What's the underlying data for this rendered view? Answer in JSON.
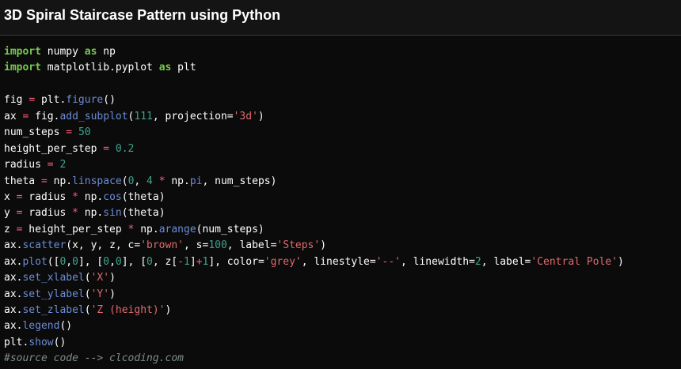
{
  "header": {
    "title": "3D Spiral Staircase Pattern using Python"
  },
  "code": {
    "lines": [
      [
        {
          "t": "import",
          "c": "kw"
        },
        {
          "t": " numpy "
        },
        {
          "t": "as",
          "c": "kw"
        },
        {
          "t": " np"
        }
      ],
      [
        {
          "t": "import",
          "c": "kw"
        },
        {
          "t": " matplotlib.pyplot "
        },
        {
          "t": "as",
          "c": "kw"
        },
        {
          "t": " plt"
        }
      ],
      [],
      [
        {
          "t": "fig "
        },
        {
          "t": "=",
          "c": "op"
        },
        {
          "t": " plt."
        },
        {
          "t": "figure",
          "c": "fn"
        },
        {
          "t": "()"
        }
      ],
      [
        {
          "t": "ax "
        },
        {
          "t": "=",
          "c": "op"
        },
        {
          "t": " fig."
        },
        {
          "t": "add_subplot",
          "c": "fn"
        },
        {
          "t": "("
        },
        {
          "t": "111",
          "c": "num"
        },
        {
          "t": ", projection="
        },
        {
          "t": "'3d'",
          "c": "str"
        },
        {
          "t": ")"
        }
      ],
      [
        {
          "t": "num_steps "
        },
        {
          "t": "=",
          "c": "op"
        },
        {
          "t": " "
        },
        {
          "t": "50",
          "c": "num"
        }
      ],
      [
        {
          "t": "height_per_step "
        },
        {
          "t": "=",
          "c": "op"
        },
        {
          "t": " "
        },
        {
          "t": "0.2",
          "c": "num"
        }
      ],
      [
        {
          "t": "radius "
        },
        {
          "t": "=",
          "c": "op"
        },
        {
          "t": " "
        },
        {
          "t": "2",
          "c": "num"
        }
      ],
      [
        {
          "t": "theta "
        },
        {
          "t": "=",
          "c": "op"
        },
        {
          "t": " np."
        },
        {
          "t": "linspace",
          "c": "fn"
        },
        {
          "t": "("
        },
        {
          "t": "0",
          "c": "num"
        },
        {
          "t": ", "
        },
        {
          "t": "4",
          "c": "num"
        },
        {
          "t": " "
        },
        {
          "t": "*",
          "c": "op"
        },
        {
          "t": " np."
        },
        {
          "t": "pi",
          "c": "fn"
        },
        {
          "t": ", num_steps)"
        }
      ],
      [
        {
          "t": "x "
        },
        {
          "t": "=",
          "c": "op"
        },
        {
          "t": " radius "
        },
        {
          "t": "*",
          "c": "op"
        },
        {
          "t": " np."
        },
        {
          "t": "cos",
          "c": "fn"
        },
        {
          "t": "(theta)"
        }
      ],
      [
        {
          "t": "y "
        },
        {
          "t": "=",
          "c": "op"
        },
        {
          "t": " radius "
        },
        {
          "t": "*",
          "c": "op"
        },
        {
          "t": " np."
        },
        {
          "t": "sin",
          "c": "fn"
        },
        {
          "t": "(theta)"
        }
      ],
      [
        {
          "t": "z "
        },
        {
          "t": "=",
          "c": "op"
        },
        {
          "t": " height_per_step "
        },
        {
          "t": "*",
          "c": "op"
        },
        {
          "t": " np."
        },
        {
          "t": "arange",
          "c": "fn"
        },
        {
          "t": "(num_steps)"
        }
      ],
      [
        {
          "t": "ax."
        },
        {
          "t": "scatter",
          "c": "fn"
        },
        {
          "t": "(x, y, z, c="
        },
        {
          "t": "'brown'",
          "c": "str"
        },
        {
          "t": ", s="
        },
        {
          "t": "100",
          "c": "num"
        },
        {
          "t": ", label="
        },
        {
          "t": "'Steps'",
          "c": "str"
        },
        {
          "t": ")"
        }
      ],
      [
        {
          "t": "ax."
        },
        {
          "t": "plot",
          "c": "fn"
        },
        {
          "t": "(["
        },
        {
          "t": "0",
          "c": "num"
        },
        {
          "t": ","
        },
        {
          "t": "0",
          "c": "num"
        },
        {
          "t": "], ["
        },
        {
          "t": "0",
          "c": "num"
        },
        {
          "t": ","
        },
        {
          "t": "0",
          "c": "num"
        },
        {
          "t": "], ["
        },
        {
          "t": "0",
          "c": "num"
        },
        {
          "t": ", z["
        },
        {
          "t": "-",
          "c": "op"
        },
        {
          "t": "1",
          "c": "num"
        },
        {
          "t": "]"
        },
        {
          "t": "+",
          "c": "op"
        },
        {
          "t": "1",
          "c": "num"
        },
        {
          "t": "], color="
        },
        {
          "t": "'grey'",
          "c": "str"
        },
        {
          "t": ", linestyle="
        },
        {
          "t": "'--'",
          "c": "str"
        },
        {
          "t": ", linewidth="
        },
        {
          "t": "2",
          "c": "num"
        },
        {
          "t": ", label="
        },
        {
          "t": "'Central Pole'",
          "c": "str"
        },
        {
          "t": ")"
        }
      ],
      [
        {
          "t": "ax."
        },
        {
          "t": "set_xlabel",
          "c": "fn"
        },
        {
          "t": "("
        },
        {
          "t": "'X'",
          "c": "str"
        },
        {
          "t": ")"
        }
      ],
      [
        {
          "t": "ax."
        },
        {
          "t": "set_ylabel",
          "c": "fn"
        },
        {
          "t": "("
        },
        {
          "t": "'Y'",
          "c": "str"
        },
        {
          "t": ")"
        }
      ],
      [
        {
          "t": "ax."
        },
        {
          "t": "set_zlabel",
          "c": "fn"
        },
        {
          "t": "("
        },
        {
          "t": "'Z (height)'",
          "c": "str"
        },
        {
          "t": ")"
        }
      ],
      [
        {
          "t": "ax."
        },
        {
          "t": "legend",
          "c": "fn"
        },
        {
          "t": "()"
        }
      ],
      [
        {
          "t": "plt."
        },
        {
          "t": "show",
          "c": "fn"
        },
        {
          "t": "()"
        }
      ],
      [
        {
          "t": "#source code --> clcoding.com",
          "c": "cm"
        }
      ]
    ]
  },
  "colors": {
    "background": "#0b0b0b",
    "header_background": "#141414",
    "keyword": "#78c850",
    "function": "#6c8cd5",
    "number": "#3fa38f",
    "string": "#e06a6f",
    "operator": "#ff5c79",
    "comment": "#7f8c8d"
  }
}
